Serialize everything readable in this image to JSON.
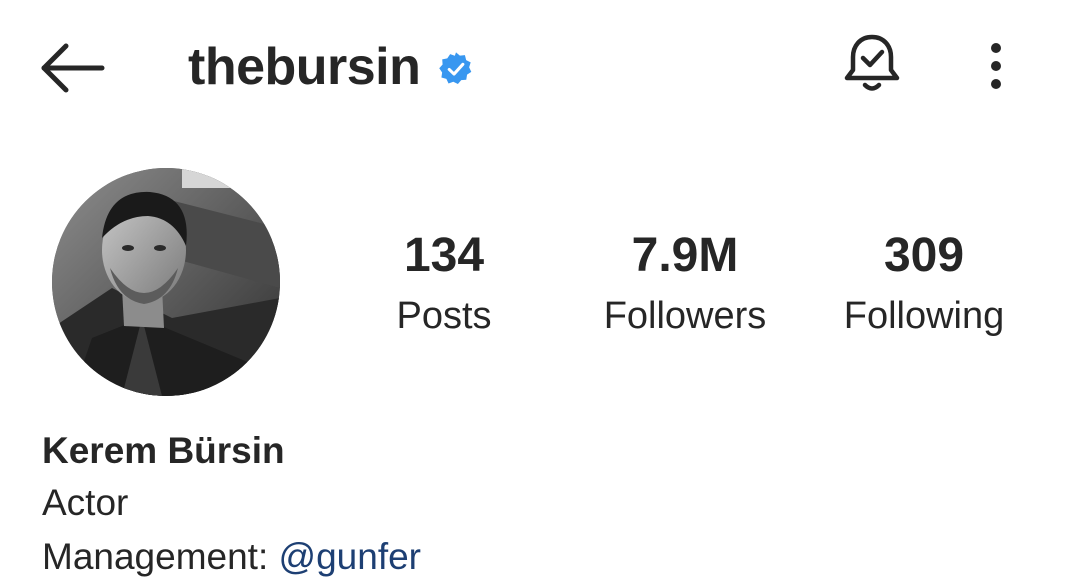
{
  "header": {
    "username": "thebursin",
    "verified": true,
    "icons": {
      "back": "back-arrow-icon",
      "verified": "verified-badge-icon",
      "notifications": "bell-check-icon",
      "more": "more-vertical-icon"
    }
  },
  "profile": {
    "avatar": "profile-photo"
  },
  "stats": {
    "posts": {
      "value": "134",
      "label": "Posts"
    },
    "followers": {
      "value": "7.9M",
      "label": "Followers"
    },
    "following": {
      "value": "309",
      "label": "Following"
    }
  },
  "bio": {
    "name": "Kerem Bürsin",
    "category": "Actor",
    "management_label": "Management: ",
    "management_handle": "@gunfer"
  },
  "colors": {
    "text": "#262626",
    "verified_blue": "#3897f0",
    "mention": "#1d3f73",
    "background": "#ffffff"
  }
}
